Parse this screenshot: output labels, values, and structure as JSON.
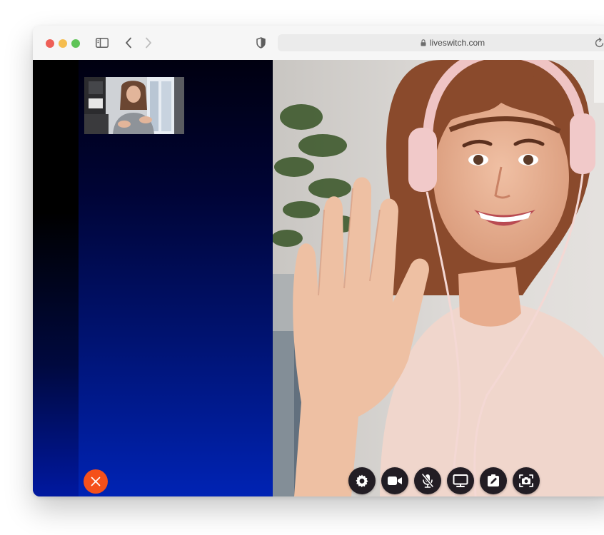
{
  "browser": {
    "url": "liveswitch.com",
    "icons": {
      "sidebar": "sidebar-toggle-icon",
      "back": "chevron-left-icon",
      "forward": "chevron-right-icon",
      "shield": "shield-icon",
      "lock": "lock-icon",
      "reload": "reload-icon"
    }
  },
  "call": {
    "hangup_icon": "close-icon",
    "controls": [
      {
        "name": "settings",
        "icon": "gear-icon"
      },
      {
        "name": "camera",
        "icon": "video-camera-icon"
      },
      {
        "name": "microphone",
        "icon": "microphone-muted-icon"
      },
      {
        "name": "screen-share",
        "icon": "monitor-icon"
      },
      {
        "name": "whiteboard",
        "icon": "pen-tablet-icon"
      },
      {
        "name": "snapshot",
        "icon": "capture-camera-icon"
      }
    ]
  },
  "colors": {
    "hangup": "#f5501a",
    "control_bg": "#221d24",
    "panel_top": "#000010",
    "panel_bottom": "#0023b4"
  }
}
